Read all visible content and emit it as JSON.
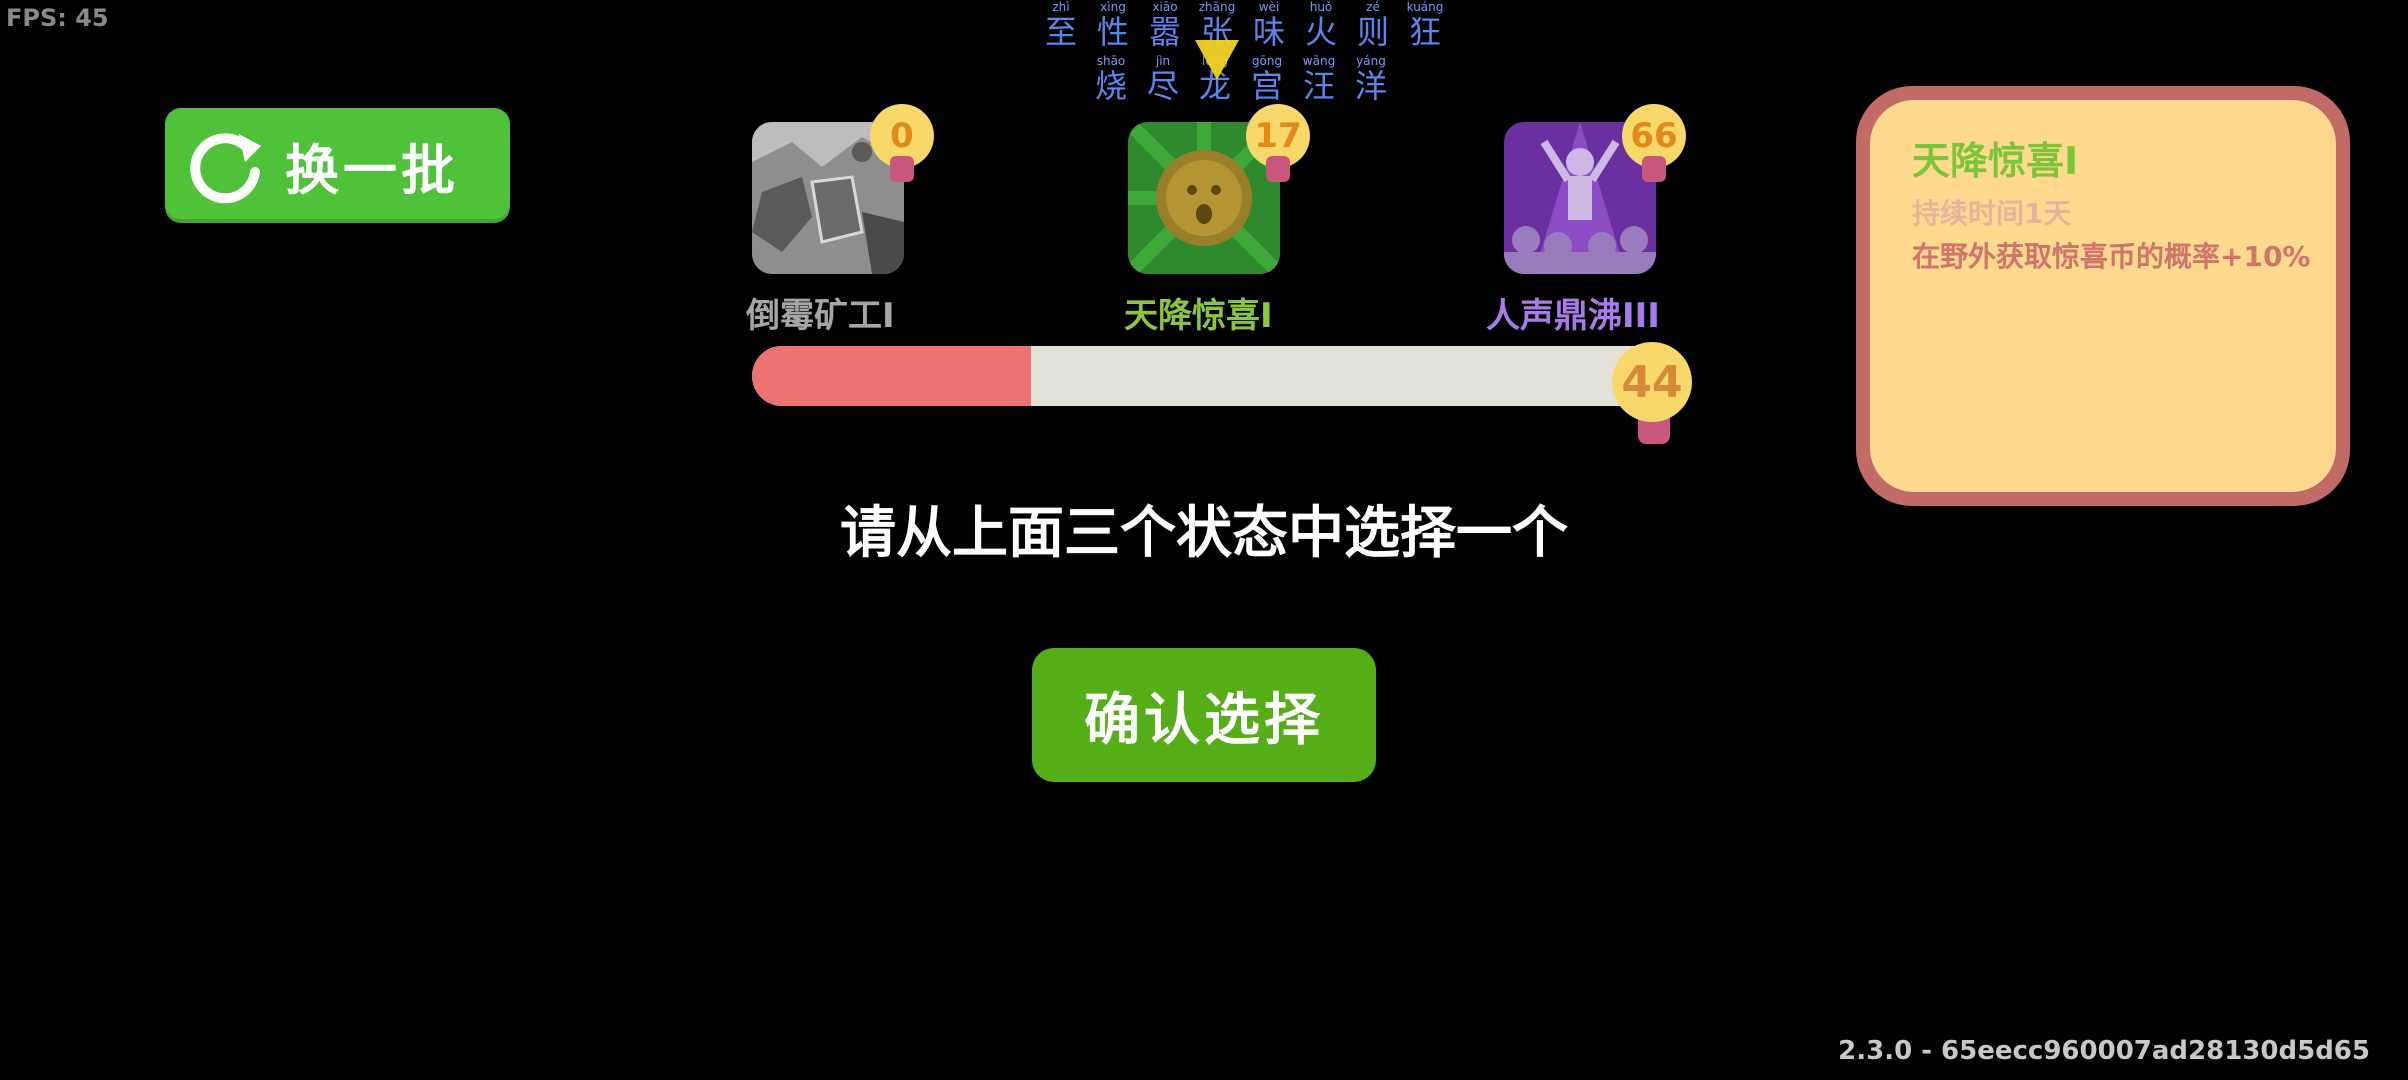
{
  "hud": {
    "fps": "FPS: 45"
  },
  "pinyin_header": {
    "row1": [
      {
        "py": "zhì",
        "hz": "至"
      },
      {
        "py": "xìng",
        "hz": "性"
      },
      {
        "py": "xiāo",
        "hz": "嚣"
      },
      {
        "py": "zhāng",
        "hz": "张"
      },
      {
        "py": "wèi",
        "hz": "味"
      },
      {
        "py": "huǒ",
        "hz": "火"
      },
      {
        "py": "zé",
        "hz": "则"
      },
      {
        "py": "kuáng",
        "hz": "狂"
      }
    ],
    "row2": [
      {
        "py": "shāo",
        "hz": "烧"
      },
      {
        "py": "jìn",
        "hz": "尽"
      },
      {
        "py": "lóng",
        "hz": "龙"
      },
      {
        "py": "gōng",
        "hz": "宫"
      },
      {
        "py": "wāng",
        "hz": "汪"
      },
      {
        "py": "yáng",
        "hz": "洋"
      }
    ]
  },
  "refresh_button": {
    "label": "换一批"
  },
  "statuses": [
    {
      "name": "倒霉矿工I",
      "count": "0",
      "color": "#a6a6a6"
    },
    {
      "name": "天降惊喜I",
      "count": "17",
      "color": "#8cc63f"
    },
    {
      "name": "人声鼎沸III",
      "count": "66",
      "color": "#a77bea"
    }
  ],
  "progress": {
    "value": "44",
    "fill_percent": 30
  },
  "prompt": "请从上面三个状态中选择一个",
  "confirm_button": {
    "label": "确认选择"
  },
  "info_panel": {
    "title": "天降惊喜I",
    "duration": "持续时间1天",
    "description": "在野外获取惊喜币的概率+10%"
  },
  "version": "2.3.0 - 65eecc960007ad28130d5d65"
}
